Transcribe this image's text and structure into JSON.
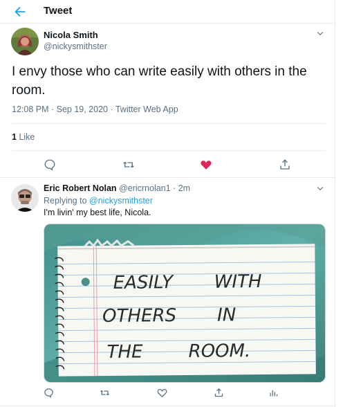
{
  "header": {
    "title": "Tweet"
  },
  "tweet": {
    "author_name": "Nicola Smith",
    "author_handle": "@nickysmithster",
    "text": "I envy those who can write easily with others in the room.",
    "meta": "12:08 PM · Sep 19, 2020 · Twitter Web App",
    "likes_count": "1",
    "likes_label": "Like"
  },
  "reply": {
    "author_name": "Eric Robert Nolan",
    "author_handle": "@ericrnolan1",
    "time": "· 2m",
    "replying_prefix": "Replying to",
    "replying_handle": "@nickysmithster",
    "text": "I'm livin' my best life, Nicola.",
    "photo_text": {
      "line1a": "EASILY",
      "line1b": "WITH",
      "line2a": "OTHERS",
      "line2b": "IN",
      "line3a": "THE",
      "line3b": "ROOM."
    }
  },
  "colors": {
    "accent": "#1da1f2",
    "like_active": "#e0245e",
    "muted": "#5b7083",
    "border": "#e6ecf0"
  },
  "icons": {
    "back": "arrow-left-icon",
    "more": "chevron-down-icon",
    "reply": "comment-icon",
    "retweet": "retweet-icon",
    "like": "heart-icon",
    "share": "share-icon",
    "analytics": "bar-chart-icon"
  }
}
